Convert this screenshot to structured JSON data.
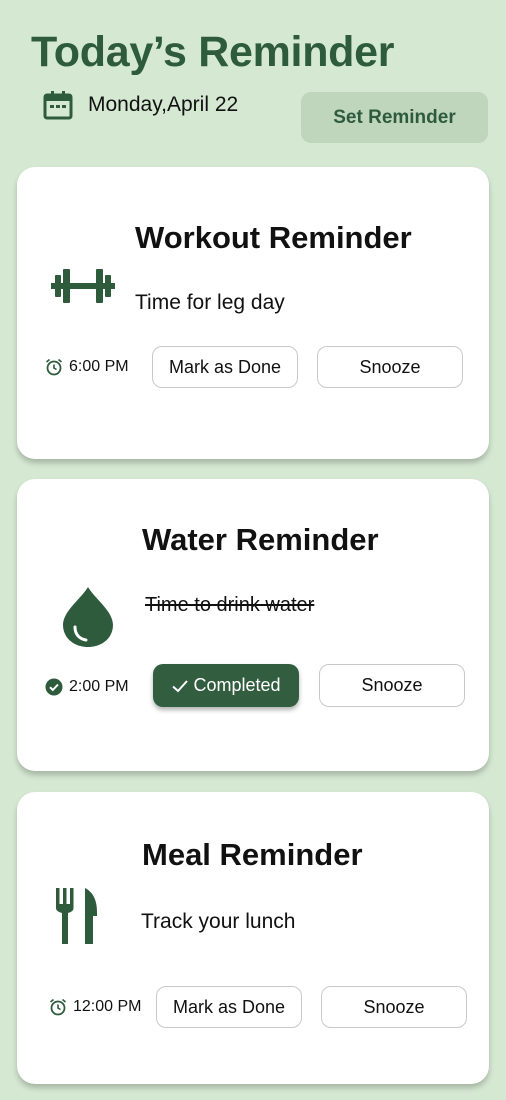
{
  "header": {
    "title": "Today’s Reminder",
    "date": "Monday,April 22",
    "set_button": "Set Reminder"
  },
  "icons": {
    "calendar": "calendar-icon",
    "alarm": "alarm-clock-icon",
    "check": "check-circle-icon",
    "dumbbell": "dumbbell-icon",
    "drop": "water-drop-icon",
    "cutlery": "fork-knife-icon"
  },
  "colors": {
    "accent": "#2e5b3c",
    "background": "#d5e9d2",
    "button_bg": "#bfd6bd",
    "completed_bg": "#325e3f"
  },
  "cards": [
    {
      "title": "Workout Reminder",
      "message": "Time for leg day",
      "time": "6:00 PM",
      "status": "pending",
      "primary": "Mark as Done",
      "secondary": "Snooze"
    },
    {
      "title": "Water Reminder",
      "message": "Time to drink water",
      "time": "2:00 PM",
      "status": "completed",
      "primary": "Completed",
      "secondary": "Snooze"
    },
    {
      "title": "Meal Reminder",
      "message": "Track your lunch",
      "time": "12:00 PM",
      "status": "pending",
      "primary": "Mark as Done",
      "secondary": "Snooze"
    }
  ]
}
